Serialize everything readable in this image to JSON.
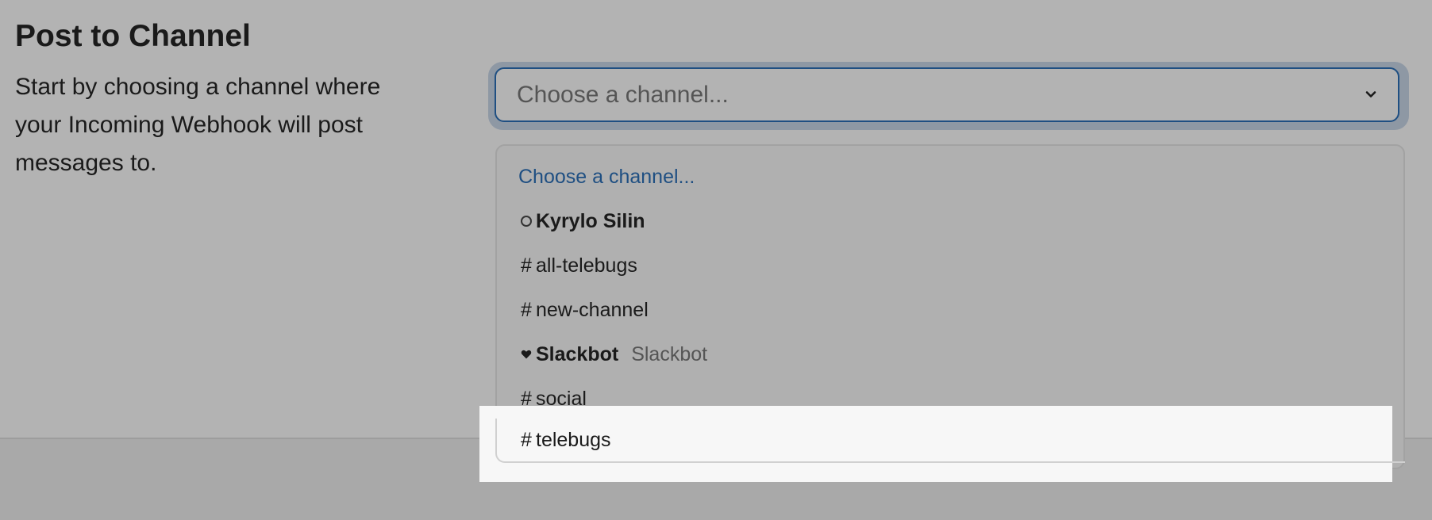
{
  "page": {
    "title": "Post to Channel",
    "description": "Start by choosing a channel where your Incoming Webhook will post messages to."
  },
  "select": {
    "current_value": "Choose a channel...",
    "icon": "chevron-down-icon"
  },
  "dropdown": {
    "options": [
      {
        "label": "Choose a channel...",
        "type": "placeholder"
      },
      {
        "label": "Kyrylo Silin",
        "type": "user",
        "icon": "presence-circle-icon"
      },
      {
        "label": "all-telebugs",
        "type": "channel",
        "icon": "hash-icon"
      },
      {
        "label": "new-channel",
        "type": "channel",
        "icon": "hash-icon"
      },
      {
        "label": "Slackbot",
        "secondary": "Slackbot",
        "type": "bot",
        "icon": "heart-icon"
      },
      {
        "label": "social",
        "type": "channel",
        "icon": "hash-icon"
      },
      {
        "label": "telebugs",
        "type": "channel",
        "icon": "hash-icon",
        "highlighted": true
      }
    ]
  },
  "colors": {
    "accent": "#1f4f82",
    "overlay": "#b3b3b3",
    "highlight": "#f7f7f7"
  }
}
